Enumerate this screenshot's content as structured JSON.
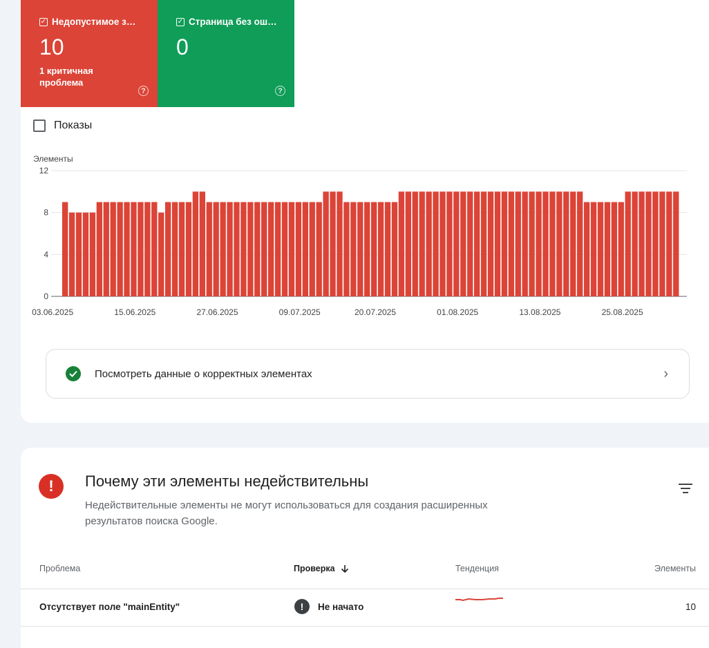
{
  "tiles": [
    {
      "title": "Недопустимое з…",
      "value": "10",
      "subtitle": "1 критичная проблема",
      "color": "#db4437"
    },
    {
      "title": "Страница без ош…",
      "value": "0",
      "subtitle": "",
      "color": "#0f9d58"
    }
  ],
  "impressions_label": "Показы",
  "chart_data": {
    "type": "bar",
    "ylabel": "Элементы",
    "ylim": [
      0,
      12
    ],
    "yticks": [
      0,
      4,
      8,
      12
    ],
    "xtick_labels": [
      "03.06.2025",
      "15.06.2025",
      "27.06.2025",
      "09.07.2025",
      "20.07.2025",
      "01.08.2025",
      "13.08.2025",
      "25.08.2025"
    ],
    "xtick_index": [
      1,
      13,
      25,
      37,
      48,
      60,
      72,
      84
    ],
    "values": [
      9,
      8,
      8,
      8,
      8,
      9,
      9,
      9,
      9,
      9,
      9,
      9,
      9,
      9,
      8,
      9,
      9,
      9,
      9,
      10,
      10,
      9,
      9,
      9,
      9,
      9,
      9,
      9,
      9,
      9,
      9,
      9,
      9,
      9,
      9,
      9,
      9,
      9,
      10,
      10,
      10,
      9,
      9,
      9,
      9,
      9,
      9,
      9,
      9,
      10,
      10,
      10,
      10,
      10,
      10,
      10,
      10,
      10,
      10,
      10,
      10,
      10,
      10,
      10,
      10,
      10,
      10,
      10,
      10,
      10,
      10,
      10,
      10,
      10,
      10,
      10,
      9,
      9,
      9,
      9,
      9,
      9,
      10,
      10,
      10,
      10,
      10,
      10,
      10,
      10
    ],
    "color": "#db4437",
    "grid": true
  },
  "valid_link_label": "Посмотреть данные о корректных элементах",
  "section": {
    "title": "Почему эти элементы недействительны",
    "description": "Недействительные элементы не могут использоваться для создания расширенных результатов поиска Google."
  },
  "table": {
    "headers": {
      "issue": "Проблема",
      "validation": "Проверка",
      "trend": "Тенденция",
      "items": "Элементы"
    },
    "rows": [
      {
        "issue": "Отсутствует поле \"mainEntity\"",
        "validation": "Не начато",
        "items": "10",
        "trend_color": "#db4437"
      }
    ]
  }
}
